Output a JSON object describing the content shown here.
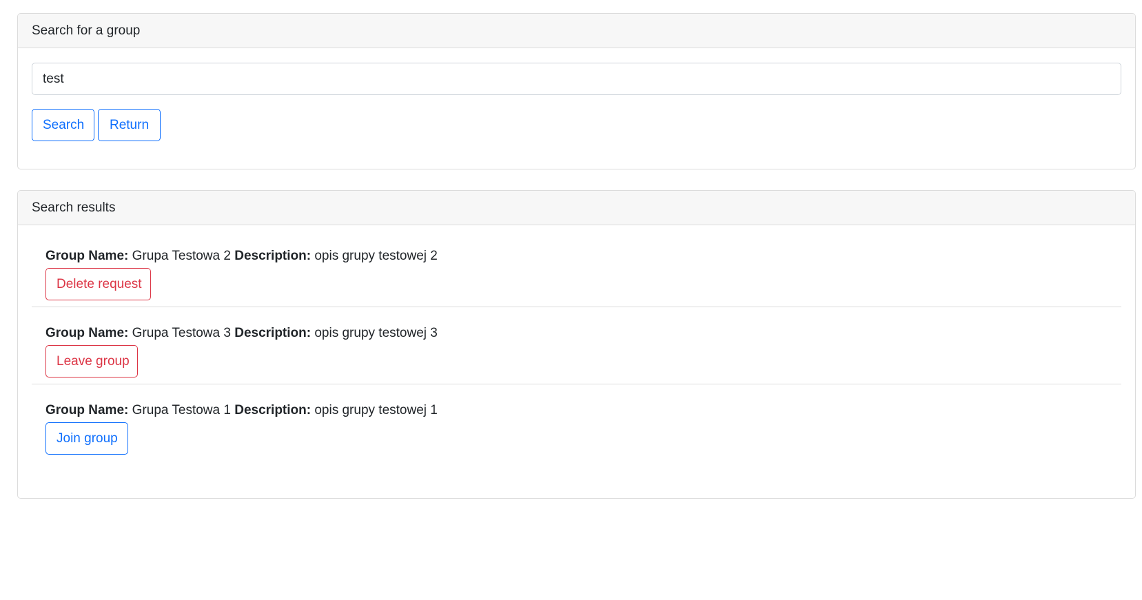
{
  "search_card": {
    "header": "Search for a group",
    "input_value": "test",
    "search_label": "Search",
    "return_label": "Return"
  },
  "results_card": {
    "header": "Search results",
    "labels": {
      "group_name": "Group Name:",
      "description": "Description:"
    },
    "items": [
      {
        "group_name": "Grupa Testowa 2",
        "description": "opis grupy testowej 2",
        "action_label": "Delete request",
        "action_style": "danger"
      },
      {
        "group_name": "Grupa Testowa 3",
        "description": "opis grupy testowej 3",
        "action_label": "Leave group",
        "action_style": "danger"
      },
      {
        "group_name": "Grupa Testowa 1",
        "description": "opis grupy testowej 1",
        "action_label": "Join group",
        "action_style": "primary"
      }
    ]
  },
  "colors": {
    "primary": "#0d6efd",
    "danger": "#dc3545",
    "header_bg": "#f7f7f7",
    "border": "#dcdcdc"
  }
}
